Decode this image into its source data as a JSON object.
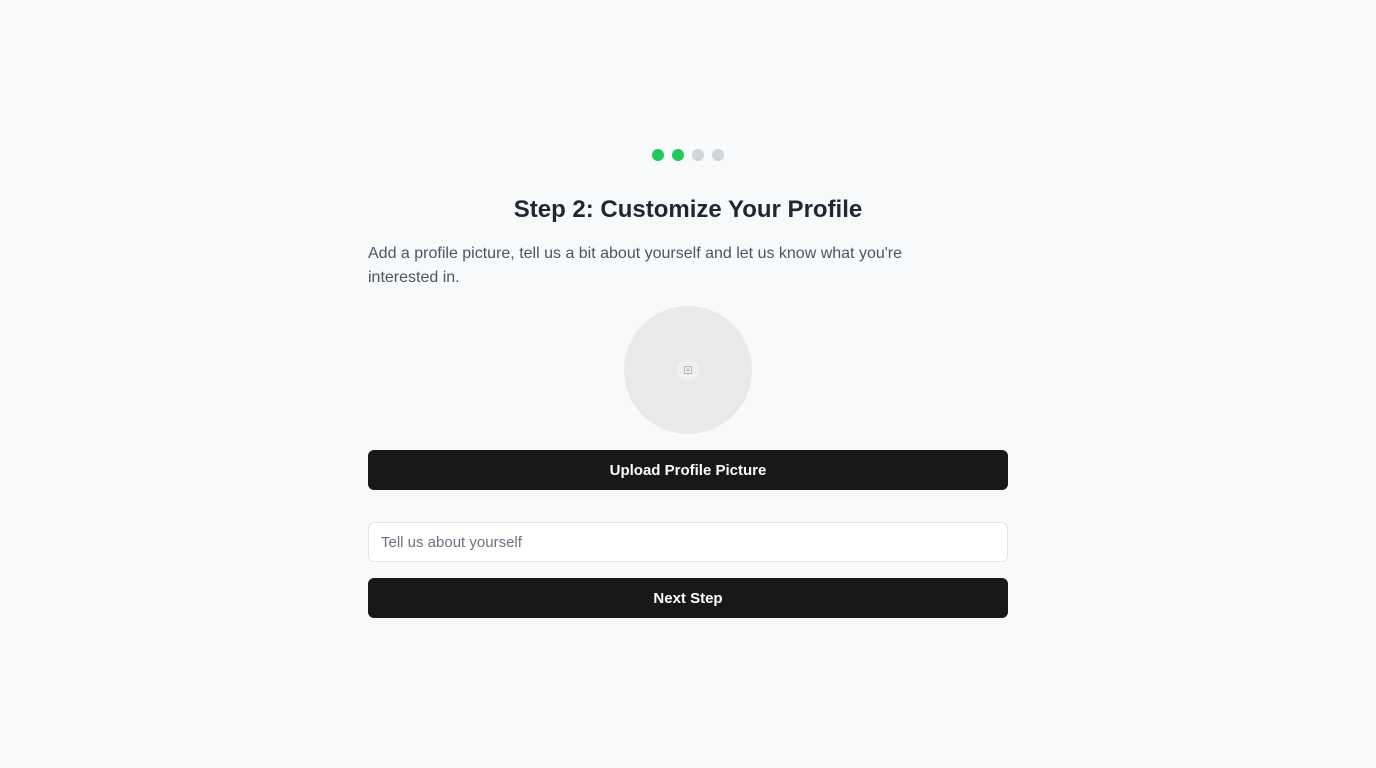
{
  "stepper": {
    "total_steps": 4,
    "current_step": 2,
    "active_color": "#22c55e",
    "inactive_color": "#d1d5db"
  },
  "header": {
    "title": "Step 2: Customize Your Profile",
    "description": "Add a profile picture, tell us a bit about yourself and let us know what you're interested in."
  },
  "avatar": {
    "icon": "image-placeholder-icon"
  },
  "upload_button": {
    "label": "Upload Profile Picture"
  },
  "bio": {
    "placeholder": "Tell us about yourself",
    "value": ""
  },
  "next_button": {
    "label": "Next Step"
  },
  "colors": {
    "background": "#f8f9fb",
    "button": "#18181b",
    "title": "#1f2733",
    "text": "#4b5563"
  }
}
